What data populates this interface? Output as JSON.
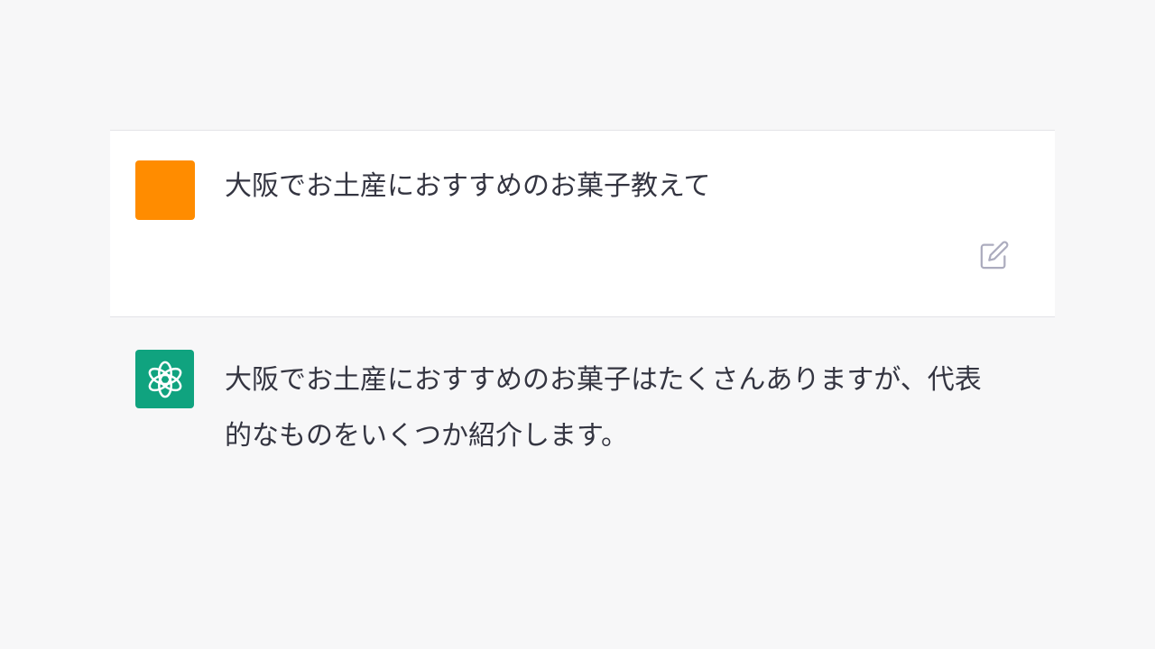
{
  "conversation": {
    "user_message": {
      "text": "大阪でお土産におすすめのお菓子教えて",
      "avatar_color": "#ff8c00",
      "edit_icon": "edit-icon"
    },
    "assistant_message": {
      "text": "大阪でお土産におすすめのお菓子はたくさんありますが、代表的なものをいくつか紹介します。",
      "avatar_color": "#10a37f",
      "avatar_icon": "openai-logo-icon"
    }
  }
}
